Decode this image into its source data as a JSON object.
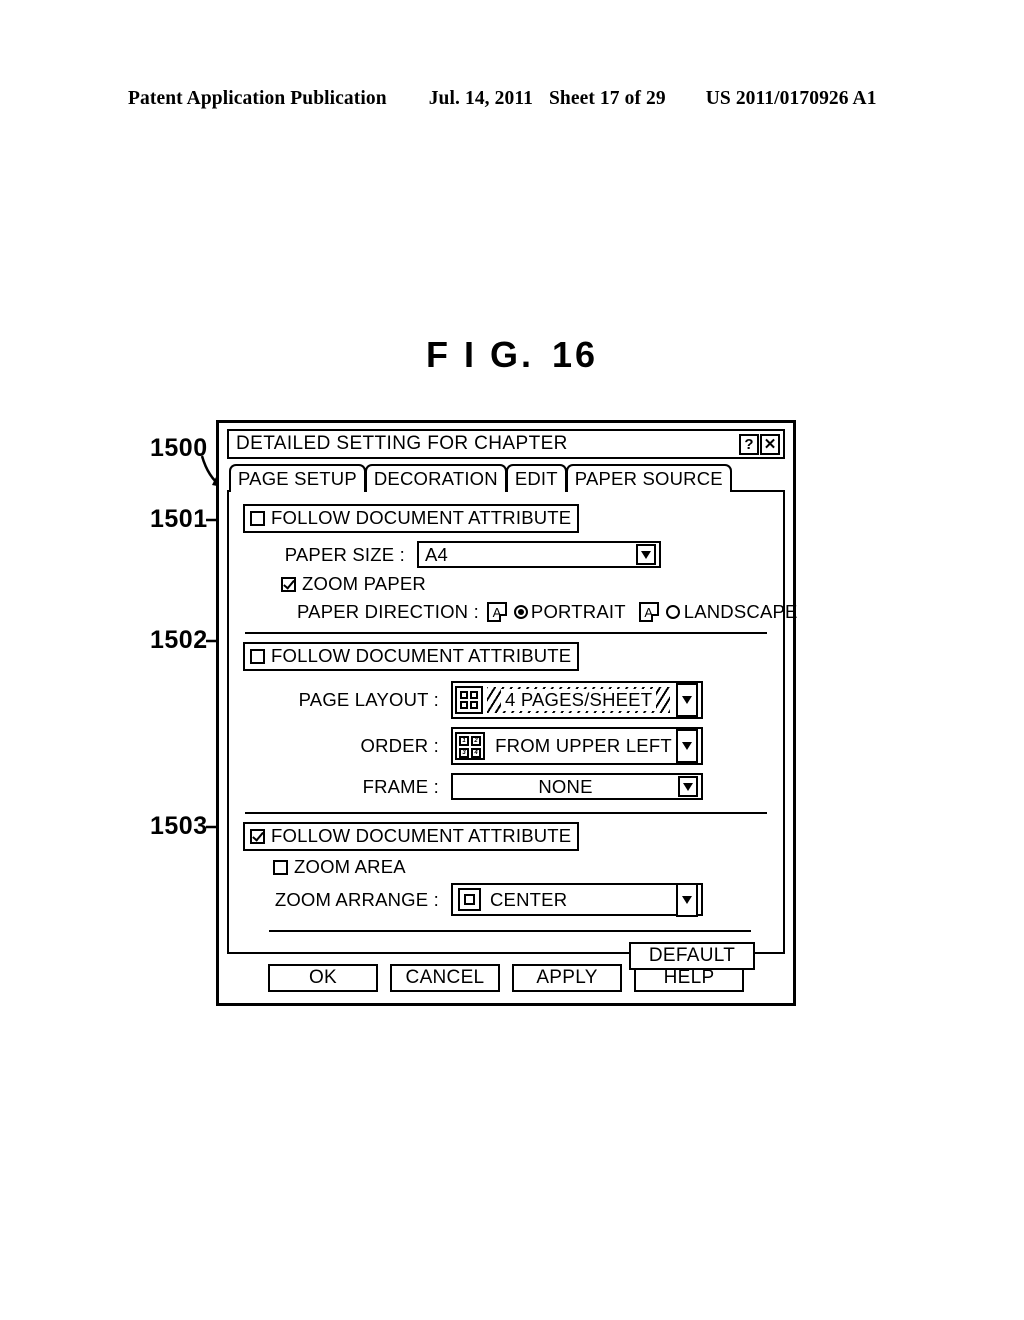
{
  "publication_header": {
    "publication": "Patent Application Publication",
    "date": "Jul. 14, 2011",
    "sheet": "Sheet 17 of 29",
    "number": "US 2011/0170926 A1"
  },
  "figure": {
    "label_fig": "F I G.",
    "label_number": "16"
  },
  "reference_numerals": {
    "dialog": "1500",
    "section_paper": "1501",
    "section_layout": "1502",
    "section_zoom": "1503"
  },
  "dialog": {
    "title": "DETAILED SETTING FOR CHAPTER",
    "help_button": "?",
    "close_button": "✕",
    "tabs": [
      {
        "label": "PAGE SETUP",
        "active": true
      },
      {
        "label": "DECORATION",
        "active": false
      },
      {
        "label": "EDIT",
        "active": false
      },
      {
        "label": "PAPER SOURCE",
        "active": false
      }
    ],
    "sections": {
      "paper": {
        "follow_label": "FOLLOW DOCUMENT ATTRIBUTE",
        "follow_checked": false,
        "paper_size_label": "PAPER SIZE :",
        "paper_size_value": "A4",
        "zoom_paper_label": "ZOOM PAPER",
        "zoom_paper_checked": true,
        "paper_direction_label": "PAPER DIRECTION :",
        "portrait_label": "PORTRAIT",
        "portrait_selected": true,
        "portrait_icon": "A",
        "landscape_label": "LANDSCAPE",
        "landscape_selected": false,
        "landscape_icon": "A"
      },
      "layout": {
        "follow_label": "FOLLOW DOCUMENT ATTRIBUTE",
        "follow_checked": false,
        "page_layout_label": "PAGE LAYOUT :",
        "page_layout_value": "4 PAGES/SHEET",
        "order_label": "ORDER :",
        "order_value": "FROM UPPER LEFT",
        "order_icon_cells": [
          "1",
          "2",
          "3",
          "4"
        ],
        "frame_label": "FRAME :",
        "frame_value": "NONE"
      },
      "zoom": {
        "follow_label": "FOLLOW DOCUMENT ATTRIBUTE",
        "follow_checked": true,
        "zoom_area_label": "ZOOM AREA",
        "zoom_area_checked": false,
        "zoom_arrange_label": "ZOOM ARRANGE :",
        "zoom_arrange_value": "CENTER"
      }
    },
    "default_button": "DEFAULT",
    "buttons": [
      {
        "label": "OK"
      },
      {
        "label": "CANCEL"
      },
      {
        "label": "APPLY"
      },
      {
        "label": "HELP"
      }
    ]
  }
}
